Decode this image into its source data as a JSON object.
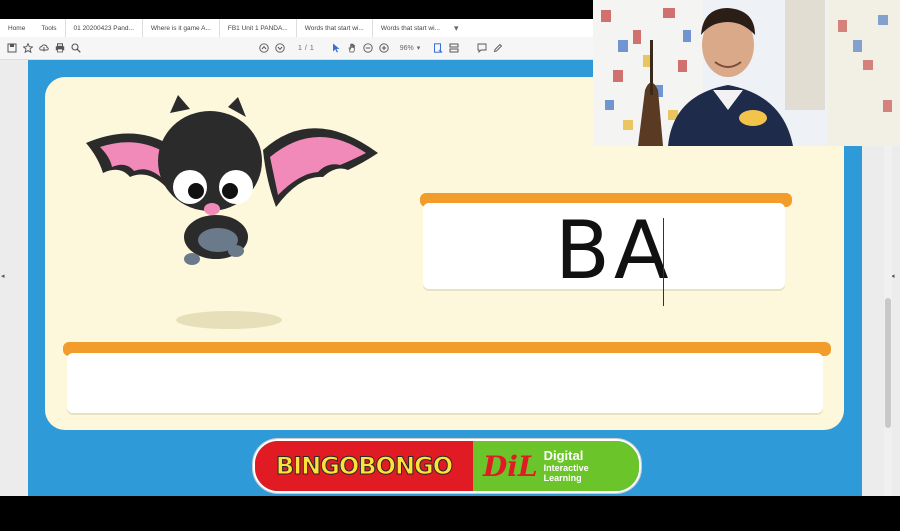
{
  "tabs": [
    {
      "label": "Home"
    },
    {
      "label": "Tools"
    },
    {
      "label": "01 20200423 Pand..."
    },
    {
      "label": "Where is it game A..."
    },
    {
      "label": "FB1 Unit 1 PANDA..."
    },
    {
      "label": "Words that start wi..."
    },
    {
      "label": "Words that start wi..."
    }
  ],
  "toolbar": {
    "page_current": "1",
    "page_sep": "/",
    "page_total": "1",
    "zoom": "96%"
  },
  "slide": {
    "answer": "BA",
    "logo_left": "BINGOBONGO",
    "logo_mark": "DiL",
    "logo_line1": "Digital",
    "logo_line2": "Interactive",
    "logo_line3": "Learning"
  },
  "colors": {
    "page_blue": "#2f9ad8",
    "card_cream": "#fdf8dc",
    "orange_bar": "#f29d2b",
    "logo_red": "#e01b23",
    "logo_green": "#6cc42b"
  }
}
